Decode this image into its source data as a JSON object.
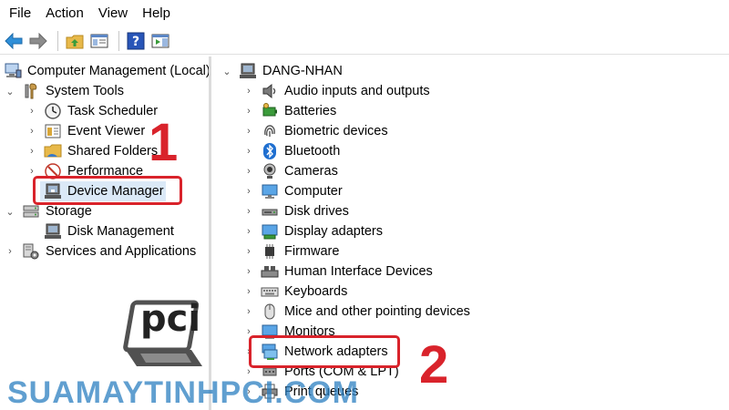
{
  "menu": [
    "File",
    "Action",
    "View",
    "Help"
  ],
  "tree_left": {
    "root": "Computer Management (Local)",
    "system_tools": "System Tools",
    "task_scheduler": "Task Scheduler",
    "event_viewer": "Event Viewer",
    "shared_folders": "Shared Folders",
    "performance": "Performance",
    "device_manager": "Device Manager",
    "storage": "Storage",
    "disk_management": "Disk Management",
    "services": "Services and Applications"
  },
  "tree_right": {
    "computer_name": "DANG-NHAN",
    "items": [
      "Audio inputs and outputs",
      "Batteries",
      "Biometric devices",
      "Bluetooth",
      "Cameras",
      "Computer",
      "Disk drives",
      "Display adapters",
      "Firmware",
      "Human Interface Devices",
      "Keyboards",
      "Mice and other pointing devices",
      "Monitors",
      "Network adapters",
      "Ports (COM & LPT)",
      "Print queues"
    ]
  },
  "annotations": {
    "step1": "1",
    "step2": "2"
  },
  "watermark": {
    "text": "SUAMAYTINHPCI.COM",
    "logo_text": "pci"
  },
  "colors": {
    "highlight": "#d9232b",
    "selection": "#dbe9f7",
    "watermark": "#2b7fc1"
  }
}
